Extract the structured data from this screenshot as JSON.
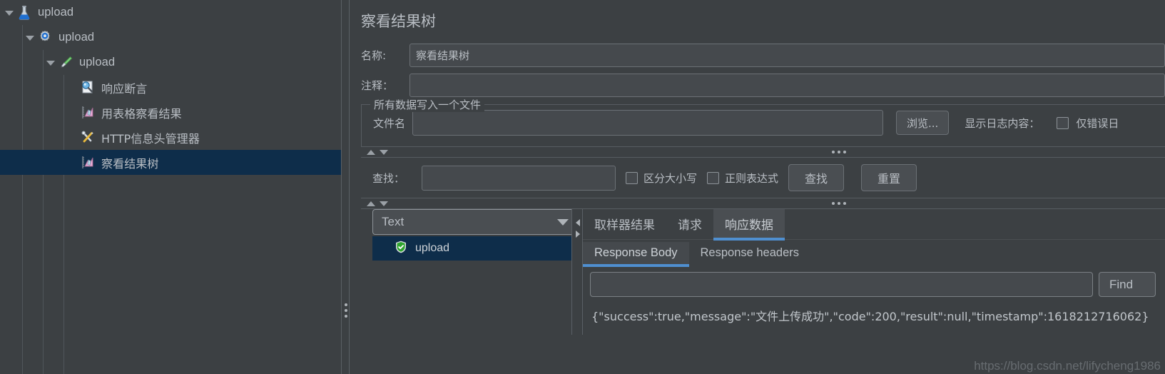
{
  "colors": {
    "background": "#3c4043",
    "selection": "#0e2d4a",
    "accent": "#4f8fd0",
    "field": "#45494d",
    "text": "#b9bec4"
  },
  "tree": {
    "items": [
      {
        "label": "upload",
        "icon": "test-plan-flask-icon",
        "depth": 0,
        "expanded": true,
        "selected": false
      },
      {
        "label": "upload",
        "icon": "thread-group-gear-icon",
        "depth": 1,
        "expanded": true,
        "selected": false
      },
      {
        "label": "upload",
        "icon": "http-sampler-pen-icon",
        "depth": 2,
        "expanded": true,
        "selected": false
      },
      {
        "label": "响应断言",
        "icon": "response-assertion-icon",
        "depth": 3,
        "expanded": false,
        "selected": false
      },
      {
        "label": "用表格察看结果",
        "icon": "view-results-table-icon",
        "depth": 3,
        "expanded": false,
        "selected": false
      },
      {
        "label": "HTTP信息头管理器",
        "icon": "header-manager-tools-icon",
        "depth": 3,
        "expanded": false,
        "selected": false
      },
      {
        "label": "察看结果树",
        "icon": "view-results-tree-icon",
        "depth": 3,
        "expanded": false,
        "selected": true
      }
    ]
  },
  "editor": {
    "title": "察看结果树",
    "name_label": "名称:",
    "name_value": "察看结果树",
    "comment_label": "注释：",
    "comment_value": "",
    "file_group": {
      "title": "所有数据写入一个文件",
      "filename_label": "文件名",
      "filename_value": "",
      "browse_label": "浏览...",
      "log_display_label": "显示日志内容：",
      "errors_only_label": "仅错误日"
    },
    "search": {
      "label": "查找：",
      "value": "",
      "case_sensitive_label": "区分大小写",
      "regex_label": "正则表达式",
      "find_button": "查找",
      "reset_button": "重置"
    },
    "renderer": {
      "selected": "Text",
      "result_label": "upload"
    },
    "tabs": [
      {
        "label": "取样器结果",
        "active": false
      },
      {
        "label": "请求",
        "active": false
      },
      {
        "label": "响应数据",
        "active": true
      }
    ],
    "subtabs": [
      {
        "label": "Response Body",
        "active": true
      },
      {
        "label": "Response headers",
        "active": false
      }
    ],
    "find_field_value": "",
    "find_button_label": "Find",
    "response_body": "{\"success\":true,\"message\":\"文件上传成功\",\"code\":200,\"result\":null,\"timestamp\":1618212716062}"
  },
  "watermark": "https://blog.csdn.net/lifycheng1986"
}
